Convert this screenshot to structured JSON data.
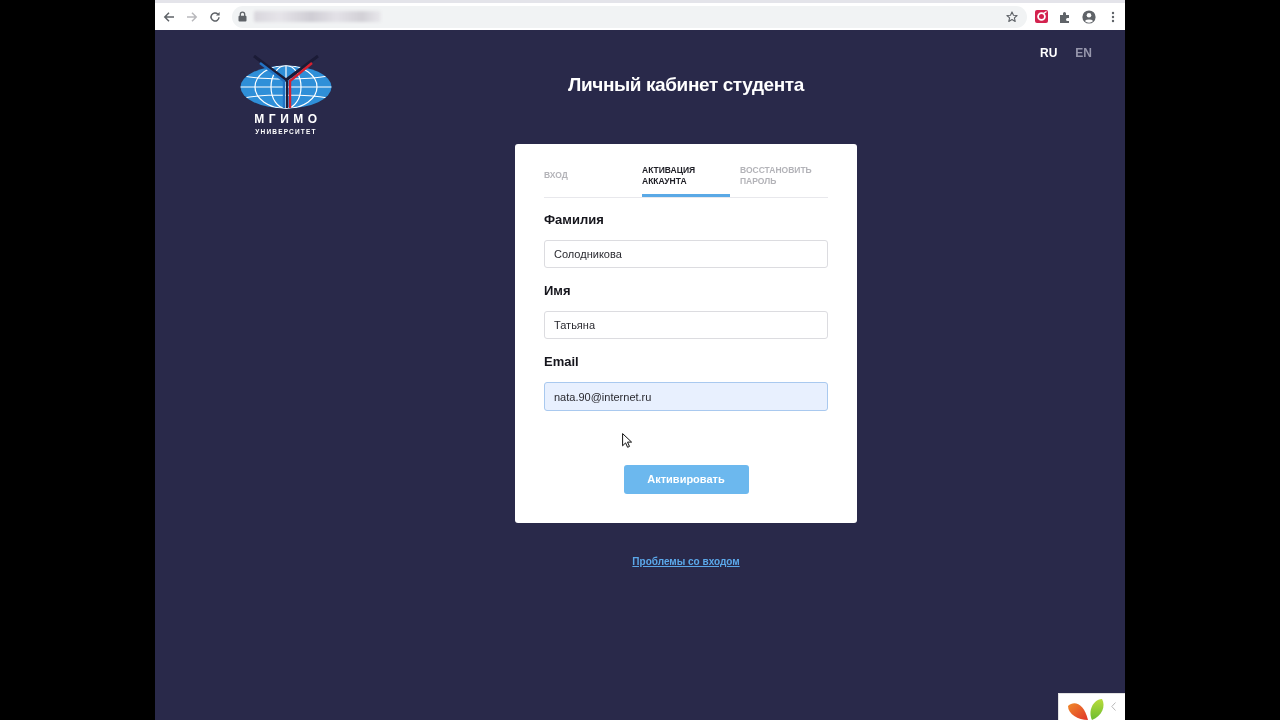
{
  "browser": {
    "nav_buttons": [
      {
        "kind": "back",
        "disabled": false
      },
      {
        "kind": "forward",
        "disabled": true
      },
      {
        "kind": "reload",
        "disabled": false
      }
    ]
  },
  "header": {
    "logo": {
      "name": "МГИМО",
      "subtitle": "УНИВЕРСИТЕТ"
    },
    "title": "Личный кабинет студента",
    "languages": [
      {
        "label": "RU",
        "selected": true
      },
      {
        "label": "EN",
        "selected": false
      }
    ]
  },
  "card": {
    "tabs": [
      {
        "label": "ВХОД",
        "selected": false
      },
      {
        "label": "АКТИВАЦИЯ АККАУНТА",
        "selected": true
      },
      {
        "label": "ВОССТАНОВИТЬ ПАРОЛЬ",
        "selected": false
      }
    ],
    "fields": [
      {
        "label": "Фамилия",
        "value": "Солодникова",
        "focused": false
      },
      {
        "label": "Имя",
        "value": "Татьяна",
        "focused": false
      },
      {
        "label": "Email",
        "value": "nata.90@internet.ru",
        "focused": true
      }
    ],
    "submit_button": "Активировать"
  },
  "help_link": "Проблемы со входом"
}
